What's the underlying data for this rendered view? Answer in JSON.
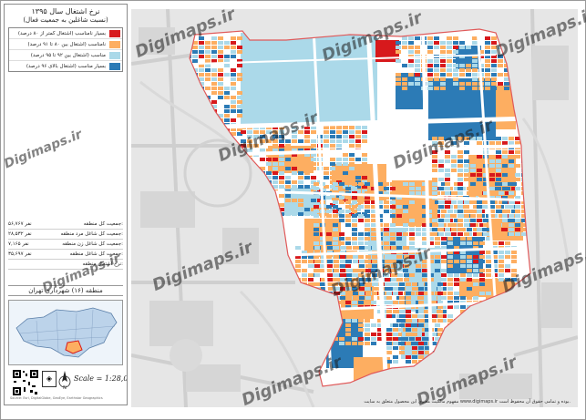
{
  "title": "نرخ اشتغال سال ۱۳۹۵",
  "subtitle": "(نسبت شاغلین به جمعیت فعال)",
  "legend": [
    {
      "label": "بسیار نامناسب (اشتغال کمتر از ۸۰ درصد)",
      "color": "#d7191c"
    },
    {
      "label": "نامناسب (اشتغال بین ۸۰ تا ۹۱ درصد)",
      "color": "#fdae61"
    },
    {
      "label": "مناسب (اشتغال بین ۹۲ تا ۹۵ درصد)",
      "color": "#abd9e9"
    },
    {
      "label": "بسیار مناسب (اشتغال بالای ۹۶ درصد)",
      "color": "#2c7bb6"
    }
  ],
  "stats": [
    {
      "label": "جمعیت کل منطقه:",
      "value": "۵۶,۷۶۷ نفر"
    },
    {
      "label": "جمعیت کل شاغل مرد منطقه:",
      "value": "۲۸,۵۳۲ نفر"
    },
    {
      "label": "جمعیت کل شاغل زن منطقه:",
      "value": "۷,۱۶۵ نفر"
    },
    {
      "label": "جمعیت کل شاغل منطقه:",
      "value": "۳۵,۶۹۷ نفر"
    },
    {
      "label": "نرخ اشتغال منطقه:",
      "value": ""
    }
  ],
  "region_label": "منطقه (۱۶) شهرداری تهران",
  "scale": "Scale = 1:28,000",
  "north": "N",
  "watermark": "Digimaps.ir",
  "footer": "مفهوم مالکیت معنوی این محصول متعلق به سایت www.digimaps.ir بوده و تمامی حقوق آن محفوظ است.",
  "copyright_tiny": "Source: Esri, DigitalGlobe, GeoEye, Earthstar Geographics"
}
